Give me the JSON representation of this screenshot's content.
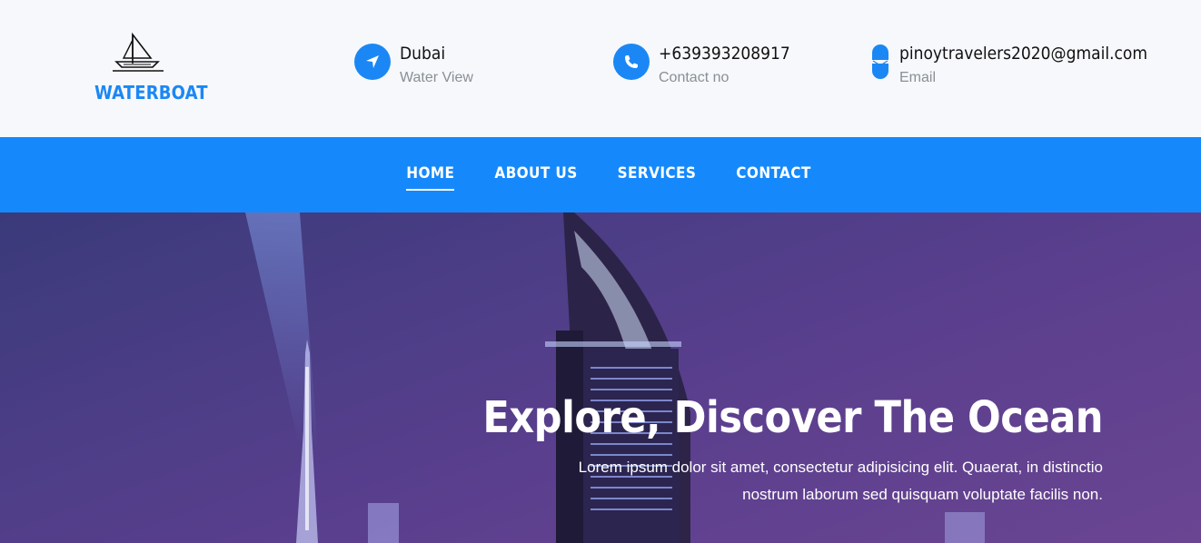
{
  "brand": {
    "name": "WATERBOAT",
    "logo_icon": "sailboat-icon",
    "color": "#1b87f5"
  },
  "contact_info": [
    {
      "icon": "location-arrow-icon",
      "title": "Dubai",
      "subtitle": "Water View"
    },
    {
      "icon": "phone-icon",
      "title": "+639393208917",
      "subtitle": "Contact no"
    },
    {
      "icon": "email-icon",
      "title": "pinoytravelers2020@gmail.com",
      "subtitle": "Email"
    }
  ],
  "nav": {
    "items": [
      {
        "label": "HOME",
        "active": true
      },
      {
        "label": "ABOUT US",
        "active": false
      },
      {
        "label": "SERVICES",
        "active": false
      },
      {
        "label": "CONTACT",
        "active": false
      }
    ],
    "color": "#1589fc"
  },
  "hero": {
    "title": "Explore, Discover The Ocean",
    "text": "Lorem ipsum dolor sit amet, consectetur adipisicing elit. Quaerat, in distinctio nostrum laborum sed quisquam voluptate facilis non."
  }
}
